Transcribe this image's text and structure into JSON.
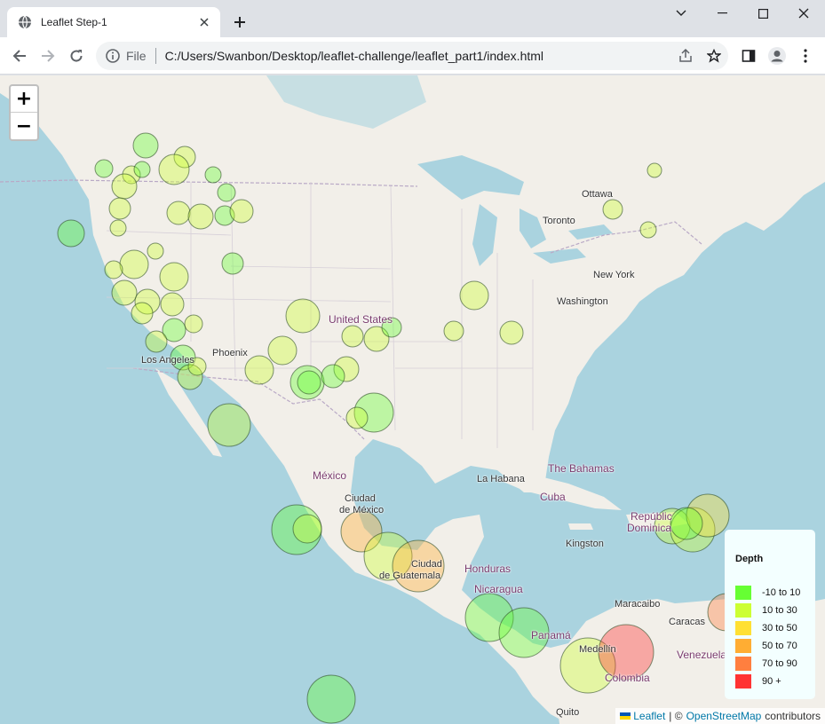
{
  "browser": {
    "tab_title": "Leaflet Step-1",
    "scheme_label": "File",
    "url": "C:/Users/Swanbon/Desktop/leaflet-challenge/leaflet_part1/index.html"
  },
  "map": {
    "zoom_in_label": "+",
    "zoom_out_label": "−",
    "labels": {
      "ottawa": "Ottawa",
      "toronto": "Toronto",
      "new_york": "New York",
      "washington": "Washington",
      "united_states": "United States",
      "phoenix": "Phoenix",
      "los_angeles": "Los Angeles",
      "mexico": "México",
      "mexico_city_1": "Ciudad",
      "mexico_city_2": "de México",
      "guatemala_1": "Ciudad",
      "guatemala_2": "de Guatemala",
      "honduras": "Honduras",
      "nicaragua": "Nicaragua",
      "panama": "Panamá",
      "la_habana": "La Habana",
      "cuba": "Cuba",
      "bahamas": "The Bahamas",
      "kingston": "Kingston",
      "republica": "Repúblic",
      "dominicana": "Dominica",
      "maracaibo": "Maracaibo",
      "caracas": "Caracas",
      "venezuela": "Venezuela",
      "medellin": "Medellín",
      "colombia": "Colombia",
      "quito": "Quito"
    },
    "legend": {
      "title": "Depth",
      "items": [
        {
          "label": "-10 to 10",
          "color": "#66ff33"
        },
        {
          "label": "10 to 30",
          "color": "#ccff33"
        },
        {
          "label": "30 to 50",
          "color": "#ffe033"
        },
        {
          "label": "50 to 70",
          "color": "#ffad33"
        },
        {
          "label": "70 to 90",
          "color": "#ff7f3f"
        },
        {
          "label": "90 +",
          "color": "#ff3333"
        }
      ]
    },
    "attribution": {
      "leaflet": "Leaflet",
      "sep": "| ©",
      "osm": "OpenStreetMap",
      "suffix": "contributors"
    }
  }
}
